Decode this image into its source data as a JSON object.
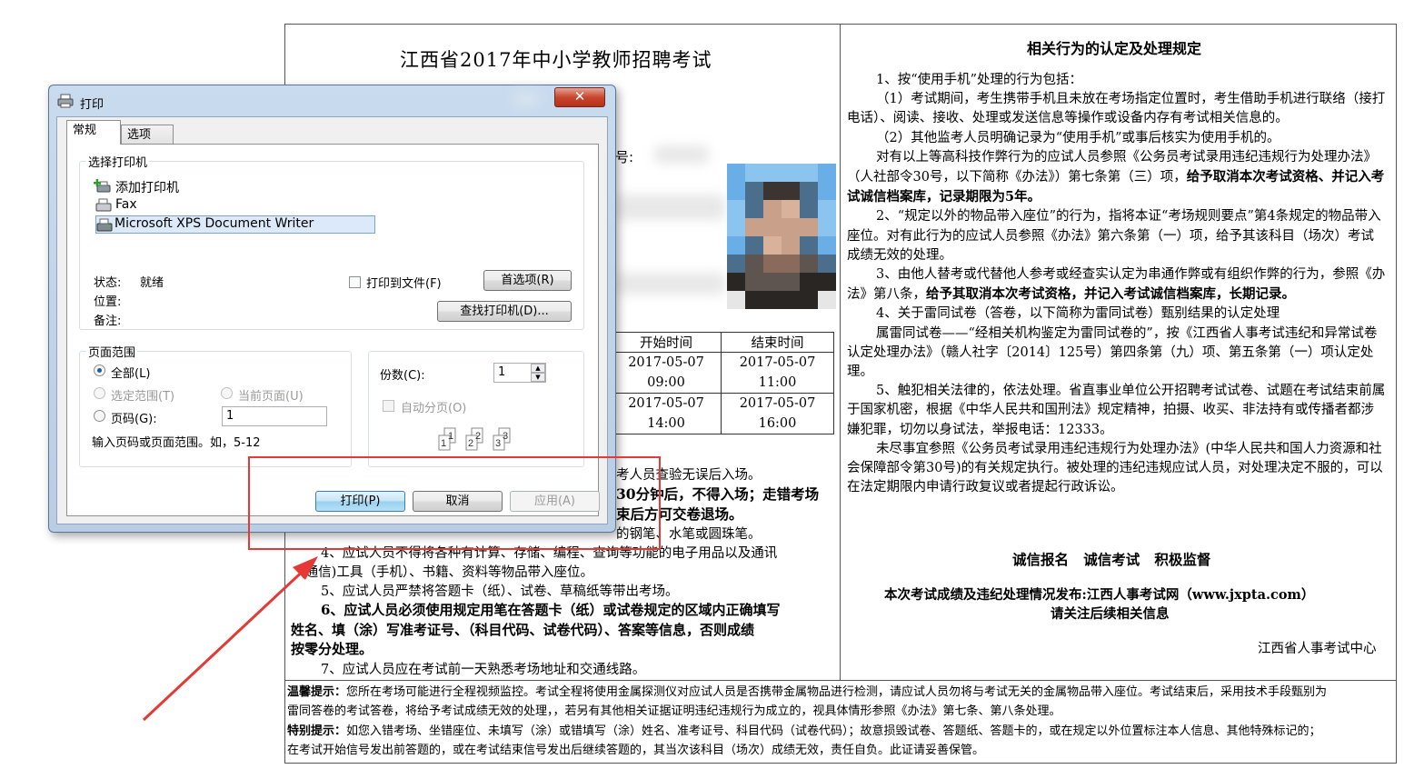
{
  "document": {
    "title": "江西省2017年中小学教师招聘考试",
    "field_label": "号:",
    "schedule": {
      "headers": [
        "开始时间",
        "结束时间"
      ],
      "rows": [
        {
          "start_date": "2017-05-07",
          "start_time": "09:00",
          "end_date": "2017-05-07",
          "end_time": "11:00"
        },
        {
          "start_date": "2017-05-07",
          "start_time": "14:00",
          "end_date": "2017-05-07",
          "end_time": "16:00"
        }
      ]
    },
    "left_rules": [
      {
        "text": "考人员查验无误后入场。",
        "bold": false
      },
      {
        "text": "30分钟后，不得入场；走错考场",
        "bold": true
      },
      {
        "text": "束后方可交卷退场。",
        "bold": true
      },
      {
        "text": "的钢笔、水笔或圆珠笔。",
        "bold": false
      },
      {
        "text": "4、应试人员不得将各种有计算、存储、编程、查询等功能的电子用品以及通讯",
        "bold": false
      },
      {
        "text": "(通信)工具（手机）、书籍、资料等物品带入座位。",
        "bold": false
      },
      {
        "text": "5、应试人员严禁将答题卡（纸）、试卷、草稿纸等带出考场。",
        "bold": false
      },
      {
        "text": "6、应试人员必须使用规定用笔在答题卡（纸）或试卷规定的区域内正确填写",
        "bold": true
      },
      {
        "text": "姓名、填（涂）写准考证号、（科目代码、试卷代码）、答案等信息，否则成绩",
        "bold": true
      },
      {
        "text": "按零分处理。",
        "bold": true
      },
      {
        "text": "7、应试人员应在考试前一天熟悉考场地址和交通线路。",
        "bold": false
      }
    ],
    "rules_title": "相关行为的认定及处理规定",
    "rules_paragraphs": [
      "1、按“使用手机”处理的行为包括：",
      "（1）考试期间，考生携带手机且未放在考场指定位置时，考生借助手机进行联络（接打电话）、阅读、接收、处理或发送信息等操作或设备内存有考试相关信息的。",
      "（2）其他监考人员明确记录为“使用手机”或事后核实为使用手机的。",
      "对有以上等高科技作弊行为的应试人员参照《公务员考试录用违纪违规行为处理办法》（人社部令30号，以下简称《办法》）第七条第（三）项，",
      "给予取消本次考试资格、并记入考试诚信档案库，记录期限为5年。",
      "2、“规定以外的物品带入座位”的行为，指将本证“考场规则要点”第4条规定的物品带入座位。对有此行为的应试人员参照《办法》第六条第（一）项，给予其该科目（场次）考试成绩无效的处理。",
      "3、由他人替考或代替他人参考或经查实认定为串通作弊或有组织作弊的行为，参照《办法》第八条，",
      "给予其取消本次考试资格，并记入考试诚信档案库，长期记录。",
      "4、关于雷同试卷（答卷，以下简称为雷同试卷）甄别结果的认定处理",
      "属雷同试卷——“经相关机构鉴定为雷同试卷的”，按《江西省人事考试违纪和异常试卷认定处理办法》（赣人社字〔2014〕125号）第四条第（九）项、第五条第（一）项认定处理。",
      "5、触犯相关法律的，依法处理。省直事业单位公开招聘考试试卷、试题在考试结束前属于国家机密，根据《中华人民共和国刑法》规定精神，拍摄、收买、非法持有或传播者都涉嫌犯罪，切勿以身试法，举报电话：12333。",
      "未尽事宜参照《公务员考试录用违纪违规行为处理办法》(中华人民共和国人力资源和社会保障部令第30号)的有关规定执行。被处理的违纪违规应试人员，对处理决定不服的，可以在法定期限内申请行政复议或者提起行政诉讼。"
    ],
    "slogan": "诚信报名   诚信考试   积极监督",
    "publish_line1": "本次考试成绩及违纪处理情况发布:江西人事考试网（www.jxpta.com）",
    "publish_line2": "请关注后续相关信息",
    "issuer": "江西省人事考试中心",
    "warm_tip_label": "温馨提示：",
    "warm_tip_line1": "您所在考场可能进行全程视频监控。考试全程将使用金属探测仪对应试人员是否携带金属物品进行检测，请应试人员勿将与考试无关的金属物品带入座位。考试结束后，采用技术手段甄别为",
    "warm_tip_line2": "雷同答卷的考试答卷，将给予考试成绩无效的处理，，若另有其他相关证据证明违纪违规行为成立的，视具体情形参照《办法》第七条、第八条处理。",
    "special_tip_label": "特别提示：",
    "special_tip_line1": "如您入错考场、坐错座位、未填写（涂）或错填写（涂）姓名、准考证号、科目代码（试卷代码）；故意损毁试卷、答题纸、答题卡的，或在规定以外位置标注本人信息、其他特殊标记的；",
    "special_tip_line2": "在考试开始信号发出前答题的，或在考试结束信号发出后继续答题的，其当次该科目（场次）成绩无效，责任自负。此证请妥善保管。"
  },
  "print_dialog": {
    "title": "打印",
    "close_label": "✕",
    "tabs": [
      "常规",
      "选项"
    ],
    "select_printer_label": "选择打印机",
    "printers": [
      {
        "name": "添加打印机",
        "icon": "add-printer-icon",
        "selected": false
      },
      {
        "name": "Fax",
        "icon": "fax-printer-icon",
        "selected": false
      },
      {
        "name": "Microsoft XPS Document Writer",
        "icon": "printer-icon",
        "selected": true
      }
    ],
    "status_label": "状态:",
    "status_value": "就绪",
    "location_label": "位置:",
    "comment_label": "备注:",
    "print_to_file_label": "打印到文件(F)",
    "preferences_label": "首选项(R)",
    "find_printer_label": "查找打印机(D)...",
    "page_range_label": "页面范围",
    "all_label": "全部(L)",
    "selection_label": "选定范围(T)",
    "current_page_label": "当前页面(U)",
    "pages_label": "页码(G):",
    "pages_value": "1",
    "pages_hint": "输入页码或页面范围。如，5-12",
    "copies_label": "份数(C):",
    "copies_value": "1",
    "collate_label": "自动分页(O)",
    "print_button": "打印(P)",
    "cancel_button": "取消",
    "apply_button": "应用(A)"
  },
  "annotation_colors": {
    "highlight": "#e53935",
    "arrow": "#e53935"
  }
}
